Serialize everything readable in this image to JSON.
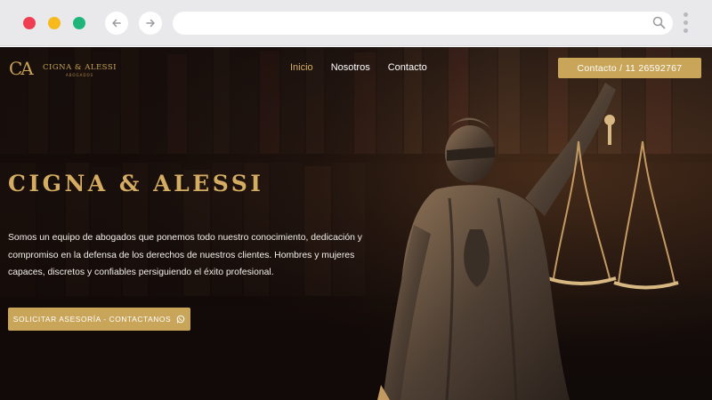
{
  "browser": {
    "icons": [
      "close-dot",
      "minimize-dot",
      "maximize-dot",
      "back-arrow-icon",
      "forward-arrow-icon",
      "search-icon",
      "more-vertical-icon"
    ],
    "url": ""
  },
  "site": {
    "logo": {
      "mark": "CA",
      "name": "CIGNA & ALESSI",
      "sub": "ABOGADOS"
    },
    "menu": [
      {
        "label": "Inicio",
        "active": true
      },
      {
        "label": "Nosotros",
        "active": false
      },
      {
        "label": "Contacto",
        "active": false
      }
    ],
    "contact_button": "Contacto / 11 26592767",
    "hero": {
      "title": "CIGNA & ALESSI",
      "text": "Somos un equipo de abogados que ponemos todo nuestro conocimiento, dedicación y compromiso en la defensa de los derechos de nuestros clientes. Hombres y mujeres capaces, discretos y confiables persiguiendo el éxito profesional.",
      "cta": "SOLICITAR ASESORÍA - CONTACTANOS",
      "cta_icon": "whatsapp-icon"
    },
    "colors": {
      "gold": "#c9a55a",
      "gold_text": "#d4ad62",
      "dark_bg": "#1a100c"
    }
  }
}
